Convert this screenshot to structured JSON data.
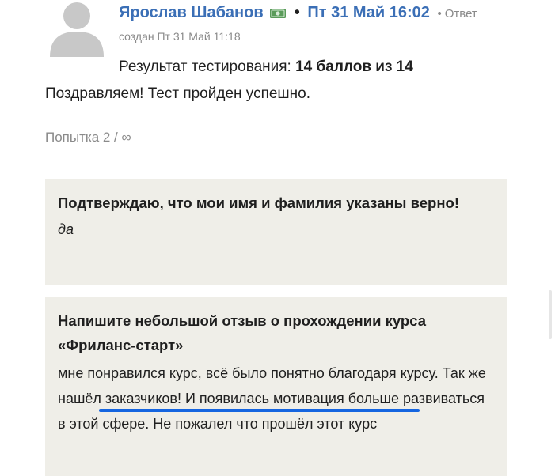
{
  "post": {
    "author": "Ярослав Шабанов",
    "separator": "•",
    "date": "Пт 31 Май 16:02",
    "reply_dot": "•",
    "reply_label": "Ответ",
    "created": "создан Пт 31 Май 11:18",
    "author_badge_icon": "money-icon",
    "avatar_icon": "user-silhouette-icon"
  },
  "result": {
    "label": "Результат тестирования:",
    "score": "14 баллов из 14",
    "message": "Поздравляем! Тест пройден успешно."
  },
  "attempt": {
    "text": "Попытка 2 / ∞"
  },
  "answers": [
    {
      "question": "Подтверждаю, что мои имя и фамилия указаны верно!",
      "answer": "да"
    },
    {
      "question": "Напишите небольшой отзыв о прохождении курса «Фриланс-старт»",
      "answer": "мне понравился курс, всё было понятно благодаря курсу. Так же нашёл заказчиков! И появилась мотивация больше развиваться в этой сфере. Не пожалел что прошёл этот курс"
    }
  ],
  "colors": {
    "link": "#3b6fb6",
    "muted": "#8a8a8a",
    "box_bg": "#efeee8",
    "highlight_underline": "#1565e0"
  }
}
